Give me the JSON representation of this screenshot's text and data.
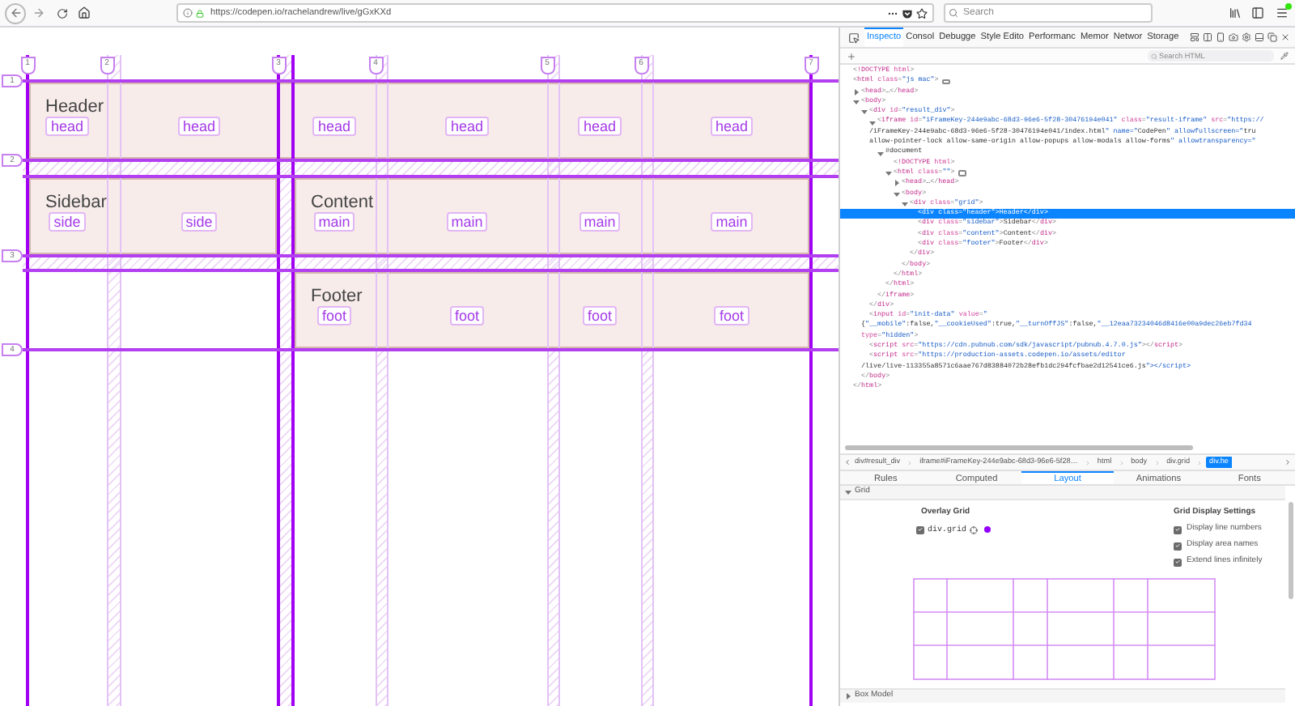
{
  "browser": {
    "url": "https://codepen.io/rachelandrew/live/gGxKXd",
    "search": {
      "placeholder": "Search"
    }
  },
  "page": {
    "column_numbers": [
      "1",
      "2",
      "3",
      "4",
      "5",
      "6",
      "7"
    ],
    "row_numbers": [
      "1",
      "2",
      "3",
      "4"
    ],
    "areas": [
      {
        "title": "Header",
        "names": [
          "head",
          "head",
          "head",
          "head",
          "head",
          "head"
        ]
      },
      {
        "title": "Sidebar",
        "names": [
          "side",
          "side"
        ]
      },
      {
        "title": "Content",
        "names": [
          "main",
          "main",
          "main",
          "main"
        ]
      },
      {
        "title": "Footer",
        "names": [
          "foot",
          "foot",
          "foot",
          "foot"
        ]
      }
    ]
  },
  "devtools": {
    "tabs": [
      {
        "label": "Inspecto",
        "selected": true
      },
      {
        "label": "Consol",
        "selected": false
      },
      {
        "label": "Debugge",
        "selected": false
      },
      {
        "label": "Style Edito",
        "selected": false
      },
      {
        "label": "Performanc",
        "selected": false
      },
      {
        "label": "Memor",
        "selected": false
      },
      {
        "label": "Networ",
        "selected": false
      },
      {
        "label": "Storage",
        "selected": false
      }
    ],
    "search": {
      "placeholder": "Search HTML"
    },
    "tree": [
      {
        "text": "<!DOCTYPE html>",
        "selected": false
      },
      {
        "text": "<html class=\"js mac\">",
        "event": true,
        "selected": false,
        "children": [
          {
            "text": "<head>…</head>",
            "expanded": false,
            "selected": false
          },
          {
            "text": "<body>",
            "expanded": true,
            "selected": false,
            "children": [
              {
                "text": "<div id=\"result_div\">",
                "expanded": true,
                "selected": false,
                "children": [
                  {
                    "text": "<iframe id=\"iFrameKey-244e9abc-68d3-96e6-5f28-30476194e041\" class=\"result-iframe\" src=\"https://",
                    "continuation": [
                      "/iFrameKey-244e9abc-68d3-96e6-5f28-30476194e041/index.html\" name=\"CodePen\" allowfullscreen=\"tru",
                      "allow-pointer-lock allow-same-origin allow-popups allow-modals allow-forms\" allowtransparency=\""
                    ],
                    "expanded": true,
                    "selected": false,
                    "children": [
                      {
                        "text": "#document",
                        "expanded": true,
                        "selected": false,
                        "children": [
                          {
                            "text": "<!DOCTYPE html>",
                            "selected": false
                          },
                          {
                            "text": "<html class=\"\">",
                            "event": true,
                            "expanded": true,
                            "selected": false,
                            "children": [
                              {
                                "text": "<head>…</head>",
                                "expanded": false,
                                "selected": false
                              },
                              {
                                "text": "<body>",
                                "expanded": true,
                                "selected": false,
                                "children": [
                                  {
                                    "text": "<div class=\"grid\">",
                                    "expanded": true,
                                    "selected": false,
                                    "children": [
                                      {
                                        "text": "<div class=\"header\">Header</div>",
                                        "selected": true
                                      },
                                      {
                                        "text": "<div class=\"sidebar\">Sidebar</div>",
                                        "selected": false
                                      },
                                      {
                                        "text": "<div class=\"content\">Content</div>",
                                        "selected": false
                                      },
                                      {
                                        "text": "<div class=\"footer\">Footer</div>",
                                        "selected": false
                                      }
                                    ],
                                    "closing": "</div>"
                                  }
                                ],
                                "closing": "</body>"
                              }
                            ],
                            "closing": "</html>"
                          }
                        ],
                        "closing": "</html>"
                      }
                    ],
                    "closing": "</iframe>"
                  }
                ],
                "closing": "</div>"
              },
              {
                "text": "<input id=\"init-data\" value=\"",
                "continuation": [
                  "{\"__mobile\":false,\"__cookieUsed\":true,\"__turnOffJS\":false,\"__12eaa73234046d8416e00a9dec26eb7fd34",
                  "type=\"hidden\">"
                ],
                "selected": false
              },
              {
                "text": "<script src=\"https://cdn.pubnub.com/sdk/javascript/pubnub.4.7.0.js\"></script>",
                "selected": false
              },
              {
                "text": "<script src=\"https://production-assets.codepen.io/assets/editor",
                "continuation": [
                  "/live/live-113355a8571c6aae767d83884072b28efb1dc294fcfbae2d12541ce6.js\"></script>"
                ],
                "selected": false
              }
            ],
            "closing": "</body>"
          }
        ],
        "closing": "</html>"
      }
    ],
    "breadcrumbs": [
      {
        "label": "div#result_div",
        "selected": false
      },
      {
        "label": "iframe#iFrameKey-244e9abc-68d3-96e6-5f28…",
        "selected": false
      },
      {
        "label": "html",
        "selected": false
      },
      {
        "label": "body",
        "selected": false
      },
      {
        "label": "div.grid",
        "selected": false
      },
      {
        "label": "div.he",
        "selected": true
      }
    ],
    "sidebar_tabs": [
      {
        "label": "Rules",
        "selected": false
      },
      {
        "label": "Computed",
        "selected": false
      },
      {
        "label": "Layout",
        "selected": true
      },
      {
        "label": "Animations",
        "selected": false
      },
      {
        "label": "Fonts",
        "selected": false
      }
    ],
    "grid_section": {
      "title": "Grid",
      "expanded": true,
      "overlay_heading": "Overlay Grid",
      "overlays": [
        {
          "label": "div.grid",
          "checked": true,
          "color": "#9400ff"
        }
      ],
      "settings_heading": "Grid Display Settings",
      "settings": [
        {
          "label": "Display line numbers",
          "checked": true
        },
        {
          "label": "Display area names",
          "checked": true
        },
        {
          "label": "Extend lines infinitely",
          "checked": true
        }
      ]
    },
    "box_model": {
      "title": "Box Model",
      "expanded": false
    }
  }
}
